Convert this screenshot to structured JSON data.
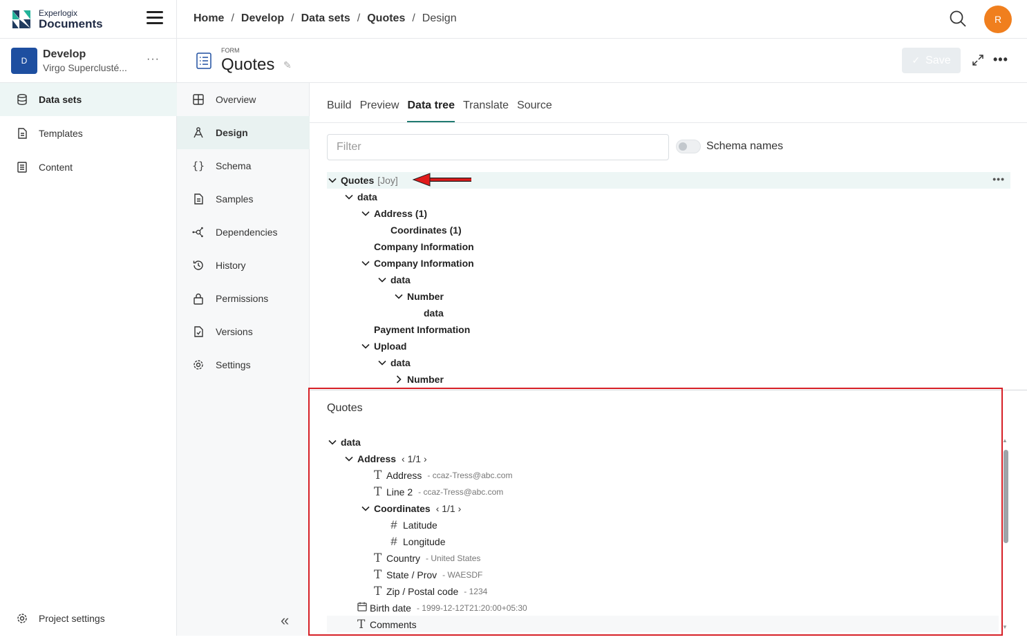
{
  "app": {
    "brand_small": "Experlogix",
    "brand_big": "Documents"
  },
  "project": {
    "initial": "D",
    "name": "Develop",
    "subtitle": "Virgo Superclusté..."
  },
  "sidebar": {
    "items": [
      {
        "label": "Data sets",
        "icon": "database-icon"
      },
      {
        "label": "Templates",
        "icon": "template-icon"
      },
      {
        "label": "Content",
        "icon": "content-icon"
      }
    ],
    "footer": "Project settings"
  },
  "breadcrumb": [
    "Home",
    "Develop",
    "Data sets",
    "Quotes",
    "Design"
  ],
  "user_initial": "R",
  "form": {
    "type_label": "FORM",
    "title": "Quotes",
    "save_label": "Save"
  },
  "subnav": [
    "Overview",
    "Design",
    "Schema",
    "Samples",
    "Dependencies",
    "History",
    "Permissions",
    "Versions",
    "Settings"
  ],
  "tabs": [
    "Build",
    "Preview",
    "Data tree",
    "Translate",
    "Source"
  ],
  "filter": {
    "placeholder": "Filter"
  },
  "schema_toggle": {
    "label": "Schema names",
    "on": false
  },
  "tree": [
    {
      "label": "Quotes",
      "tag": "[Joy]",
      "depth": 0,
      "chev": "down"
    },
    {
      "label": "data",
      "depth": 1,
      "chev": "down"
    },
    {
      "label": "Address (1)",
      "depth": 2,
      "chev": "down"
    },
    {
      "label": "Coordinates (1)",
      "depth": 3,
      "chev": "none"
    },
    {
      "label": "Company Information",
      "depth": 2,
      "chev": "none"
    },
    {
      "label": "Company Information",
      "depth": 2,
      "chev": "down"
    },
    {
      "label": "data",
      "depth": 3,
      "chev": "down"
    },
    {
      "label": "Number",
      "depth": 4,
      "chev": "down"
    },
    {
      "label": "data",
      "depth": 5,
      "chev": "none"
    },
    {
      "label": "Payment Information",
      "depth": 2,
      "chev": "none"
    },
    {
      "label": "Upload",
      "depth": 2,
      "chev": "down"
    },
    {
      "label": "data",
      "depth": 3,
      "chev": "down"
    },
    {
      "label": "Number",
      "depth": 4,
      "chev": "right"
    }
  ],
  "preview": {
    "title": "Quotes",
    "rows": [
      {
        "label": "data",
        "bold": true,
        "chev": "down",
        "depth": 0
      },
      {
        "label": "Address",
        "bold": true,
        "chev": "down",
        "depth": 1,
        "pager": "1/1"
      },
      {
        "label": "Address",
        "icon": "T",
        "depth": 2,
        "value": "- ccaz-Tress@abc.com"
      },
      {
        "label": "Line 2",
        "icon": "T",
        "depth": 2,
        "value": "- ccaz-Tress@abc.com"
      },
      {
        "label": "Coordinates",
        "bold": true,
        "chev": "down",
        "depth": 2,
        "pager": "1/1"
      },
      {
        "label": "Latitude",
        "icon": "#",
        "depth": 3
      },
      {
        "label": "Longitude",
        "icon": "#",
        "depth": 3
      },
      {
        "label": "Country",
        "icon": "T",
        "depth": 2,
        "value": "- United States"
      },
      {
        "label": "State / Prov",
        "icon": "T",
        "depth": 2,
        "value": "- WAESDF"
      },
      {
        "label": "Zip / Postal code",
        "icon": "T",
        "depth": 2,
        "value": "- 1234"
      },
      {
        "label": "Birth date",
        "icon": "cal",
        "depth": 1,
        "value": "- 1999-12-12T21:20:00+05:30"
      },
      {
        "label": "Comments",
        "icon": "T",
        "depth": 1
      }
    ]
  },
  "colors": {
    "accent": "#1f7a70",
    "brand_blue": "#1e4fa0",
    "user_orange": "#f07f1e",
    "highlight_red": "#d61f26"
  }
}
